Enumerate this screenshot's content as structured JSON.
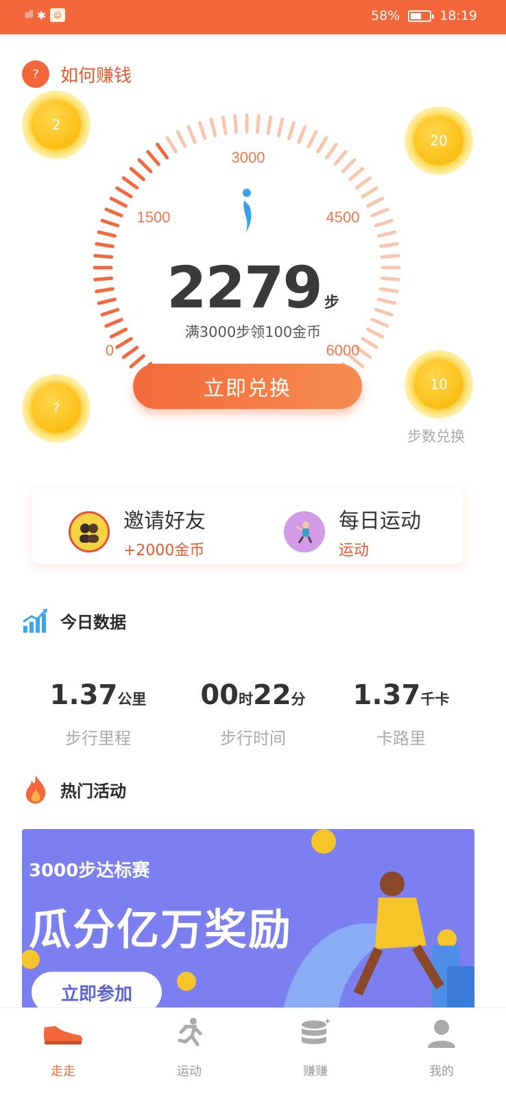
{
  "status_bar": {
    "network": "4G",
    "battery": "58%",
    "battery_level": 0.58,
    "time": "18:19"
  },
  "header": {
    "how_to_earn": "如何赚钱",
    "help_icon_text": "?"
  },
  "coins": [
    {
      "value": "2"
    },
    {
      "value": "20"
    },
    {
      "value": "?"
    },
    {
      "value": "10"
    }
  ],
  "coin_exchange_label": "步数兑换",
  "gauge": {
    "tick_labels": [
      "0",
      "1500",
      "3000",
      "4500",
      "6000"
    ],
    "max": 6000,
    "current": 2279
  },
  "steps": {
    "count": "2279",
    "unit": "步",
    "tip": "满3000步领100金币"
  },
  "exchange_button": "立即兑换",
  "cards": {
    "invite": {
      "title": "邀请好友",
      "subtitle": "+2000金币"
    },
    "daily": {
      "title": "每日运动",
      "subtitle": "运动"
    }
  },
  "today": {
    "title": "今日数据",
    "distance": {
      "value": "1.37",
      "unit": "公里",
      "label": "步行里程"
    },
    "time": {
      "hours": "00",
      "hours_unit": "时",
      "minutes": "22",
      "minutes_unit": "分",
      "label": "步行时间"
    },
    "calories": {
      "value": "1.37",
      "unit": "千卡",
      "label": "卡路里"
    }
  },
  "hot": {
    "title": "热门活动",
    "banner_sub": "3000步达标赛",
    "banner_title": "瓜分亿万奖励",
    "banner_button": "立即参加"
  },
  "bottom_nav": [
    {
      "label": "走走",
      "icon": "shoe-icon",
      "active": true
    },
    {
      "label": "运动",
      "icon": "runner-icon",
      "active": false
    },
    {
      "label": "赚赚",
      "icon": "coins-stack-icon",
      "active": false
    },
    {
      "label": "我的",
      "icon": "user-icon",
      "active": false
    }
  ],
  "colors": {
    "accent": "#f3673a",
    "coin": "#ffc21b",
    "banner": "#7b7ff0"
  }
}
